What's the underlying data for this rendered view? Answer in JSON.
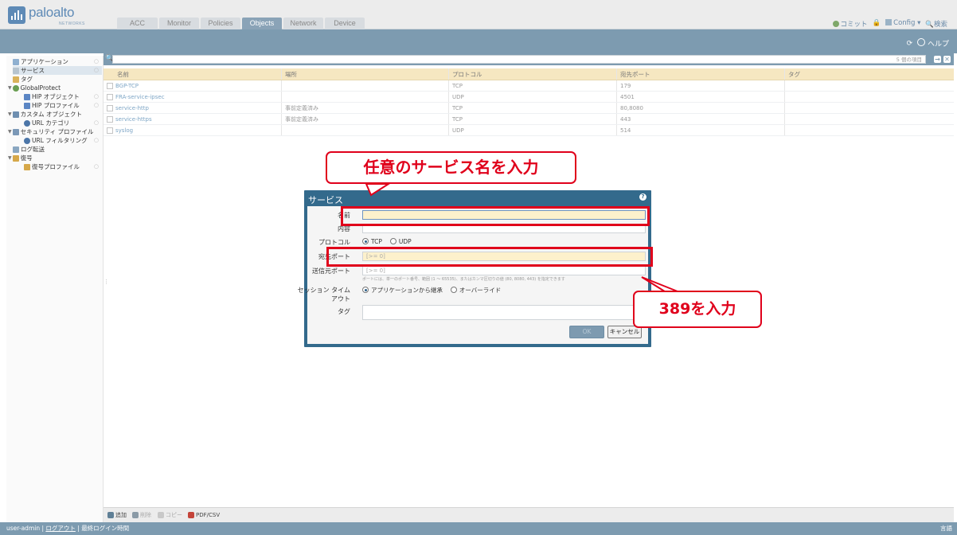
{
  "header": {
    "logo_text": "paloalto",
    "logo_sub": "NETWORKS",
    "tabs": [
      {
        "label": "ACC",
        "active": false
      },
      {
        "label": "Monitor",
        "active": false
      },
      {
        "label": "Policies",
        "active": false
      },
      {
        "label": "Objects",
        "active": true
      },
      {
        "label": "Network",
        "active": false
      },
      {
        "label": "Device",
        "active": false
      }
    ],
    "actions": {
      "commit": "コミット",
      "config": "Config",
      "search": "検索"
    },
    "help": "ヘルプ"
  },
  "sidebar": {
    "items": [
      {
        "label": "アプリケーション",
        "icon": "application-icon"
      },
      {
        "label": "サービス",
        "icon": "service-icon",
        "selected": true
      },
      {
        "label": "タグ",
        "icon": "tag-icon"
      },
      {
        "label": "GlobalProtect",
        "icon": "globalprotect-icon"
      },
      {
        "label": "HIP オブジェクト",
        "icon": "hip-object-icon"
      },
      {
        "label": "HIP プロファイル",
        "icon": "hip-profile-icon"
      },
      {
        "label": "カスタム オブジェクト",
        "icon": "custom-object-icon"
      },
      {
        "label": "URL カテゴリ",
        "icon": "url-category-icon"
      },
      {
        "label": "セキュリティ プロファイル",
        "icon": "security-profile-icon"
      },
      {
        "label": "URL フィルタリング",
        "icon": "url-filtering-icon"
      },
      {
        "label": "ログ転送",
        "icon": "log-forwarding-icon"
      },
      {
        "label": "復号",
        "icon": "decryption-icon"
      },
      {
        "label": "復号プロファイル",
        "icon": "decryption-profile-icon"
      }
    ]
  },
  "grid": {
    "count_text": "5 個の項目",
    "columns": [
      "名前",
      "場所",
      "プロトコル",
      "宛先ポート",
      "タグ"
    ],
    "rows": [
      {
        "name": "BGP-TCP",
        "location": "",
        "protocol": "TCP",
        "port": "179",
        "tag": ""
      },
      {
        "name": "FRA-service-ipsec",
        "location": "",
        "protocol": "UDP",
        "port": "4501",
        "tag": ""
      },
      {
        "name": "service-http",
        "location": "事前定義済み",
        "protocol": "TCP",
        "port": "80,8080",
        "tag": ""
      },
      {
        "name": "service-https",
        "location": "事前定義済み",
        "protocol": "TCP",
        "port": "443",
        "tag": ""
      },
      {
        "name": "syslog",
        "location": "",
        "protocol": "UDP",
        "port": "514",
        "tag": ""
      }
    ]
  },
  "bottombar": {
    "add": "追加",
    "delete": "削除",
    "copy": "コピー",
    "pdfcsv": "PDF/CSV"
  },
  "footer": {
    "user": "user-admin",
    "logout": "ログアウト",
    "last_login": "最終ログイン時間",
    "lang": "言語"
  },
  "modal": {
    "title": "サービス",
    "name_label": "名前",
    "name_value": "",
    "desc_label": "内容",
    "desc_value": "",
    "protocol_label": "プロトコル",
    "protocol_tcp": "TCP",
    "protocol_udp": "UDP",
    "dest_port_label": "宛先ポート",
    "dest_port_placeholder": "[>= 0]",
    "src_port_label": "送信元ポート",
    "src_port_placeholder": "[>= 0]",
    "port_hint": "ポートには、単一のポート番号、範囲 (1 ～ 65535)、またはカンマ区切りの値 (80, 8080, 443) を指定できます",
    "timeout_label_1": "セッション タイム",
    "timeout_label_2": "アウト",
    "timeout_inherit": "アプリケーションから継承",
    "timeout_override": "オーバーライド",
    "tag_label": "タグ",
    "ok": "OK",
    "cancel": "キャンセル"
  },
  "annotations": {
    "name_callout": "任意のサービス名を入力",
    "port_callout": "389を入力"
  },
  "colors": {
    "accent": "#7d9bb0",
    "dialog": "#336a8c",
    "annotation_red": "#e0001b",
    "header_row": "#f6e7c1"
  }
}
